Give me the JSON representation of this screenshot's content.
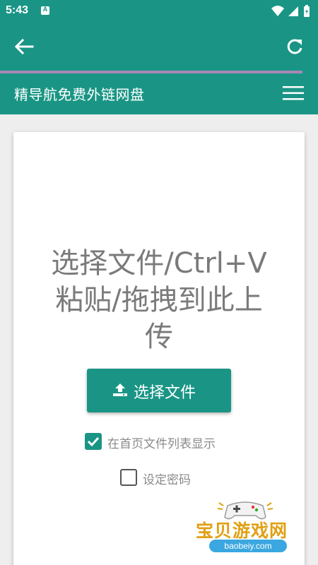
{
  "status_bar": {
    "time": "5:43",
    "notification_letter": "A"
  },
  "browser": {
    "progress_fraction": 0.95,
    "back_icon": "arrow-left-icon",
    "refresh_icon": "refresh-icon"
  },
  "site": {
    "title": "精导航免费外链网盘",
    "menu_icon": "hamburger-menu-icon"
  },
  "upload": {
    "prompt_lines": [
      "选择文件/Ctrl+V",
      "粘贴/拖拽到此上",
      "传"
    ],
    "choose_button_label": "选择文件",
    "show_on_home_label": "在首页文件列表显示",
    "show_on_home_checked": true,
    "set_password_label": "设定密码",
    "set_password_checked": false
  },
  "watermark": {
    "text": "宝贝游戏网",
    "url": "baobeiy.com"
  },
  "colors": {
    "primary": "#1a9585",
    "progress": "#a987b5",
    "text_gray": "#7a7a7a"
  }
}
